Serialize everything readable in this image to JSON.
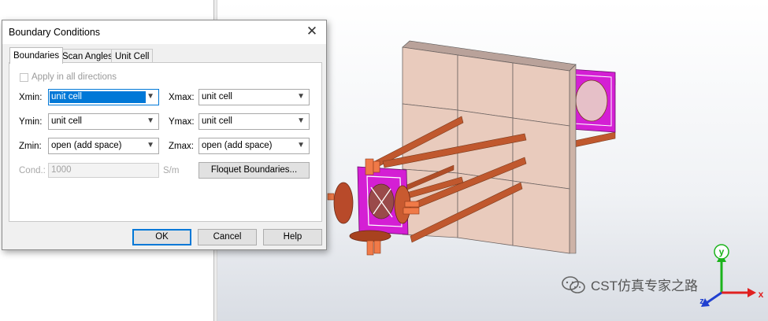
{
  "dialog": {
    "title": "Boundary Conditions",
    "tabs": [
      "Boundaries",
      "Scan Angles",
      "Unit Cell"
    ],
    "apply_all_label": "Apply in all directions",
    "rows": [
      {
        "label_left": "Xmin:",
        "value_left": "unit cell",
        "label_right": "Xmax:",
        "value_right": "unit cell"
      },
      {
        "label_left": "Ymin:",
        "value_left": "unit cell",
        "label_right": "Ymax:",
        "value_right": "unit cell"
      },
      {
        "label_left": "Zmin:",
        "value_left": "open (add space)",
        "label_right": "Zmax:",
        "value_right": "open (add space)"
      }
    ],
    "cond_label": "Cond.:",
    "cond_value": "1000",
    "cond_unit": "S/m",
    "floquet_button": "Floquet Boundaries...",
    "ok": "OK",
    "cancel": "Cancel",
    "help": "Help"
  },
  "axes": {
    "x": "x",
    "y": "y",
    "z": "z"
  },
  "watermark": "CST仿真专家之路",
  "icons": {
    "close": "close-icon",
    "dropdown": "chevron-down-icon",
    "wechat": "wechat-icon"
  },
  "colors": {
    "accent": "#0078d7",
    "copper": "#c65a2e",
    "magenta": "#d41fd4",
    "tile": "#e9cbbd"
  }
}
